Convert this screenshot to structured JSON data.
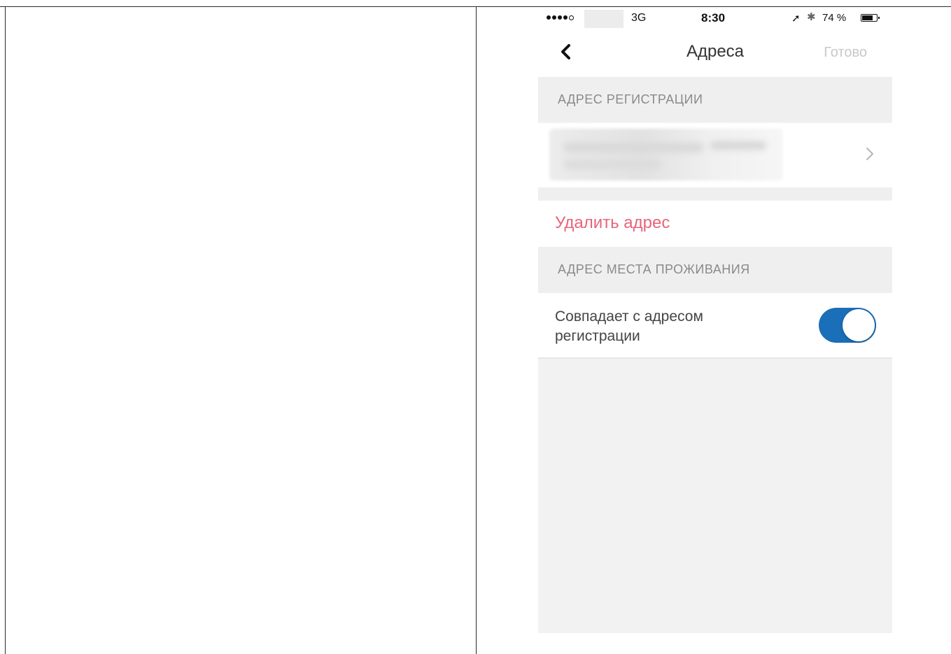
{
  "status_bar": {
    "network": "3G",
    "time": "8:30",
    "battery": "74 %"
  },
  "nav": {
    "title": "Адреса",
    "done_label": "Готово"
  },
  "registration_section": {
    "header": "АДРЕС РЕГИСТРАЦИИ",
    "delete_label": "Удалить адрес"
  },
  "residence_section": {
    "header": "АДРЕС МЕСТА ПРОЖИВАНИЯ",
    "toggle_label": "Совпадает с адресом регистрации",
    "toggle_on": true
  },
  "colors": {
    "accent_blue": "#1a6fb8",
    "delete_red": "#e8647a",
    "done_disabled": "#c8c8c8",
    "section_bg": "#efefef"
  }
}
